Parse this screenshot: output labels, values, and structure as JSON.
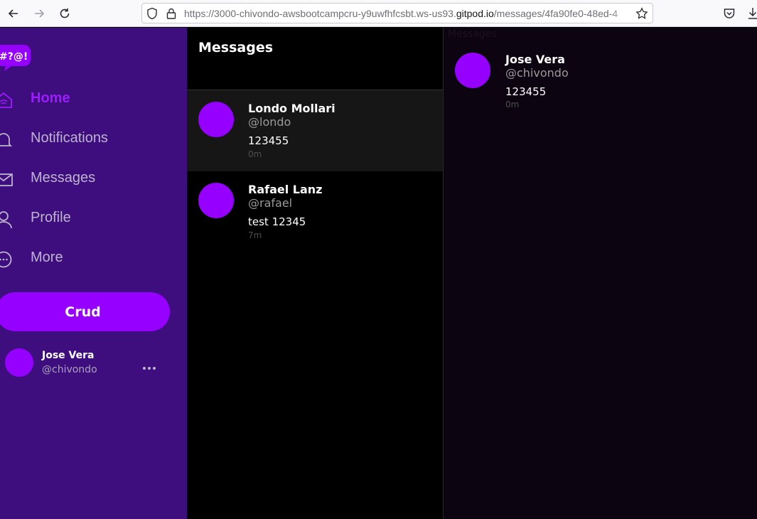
{
  "browser": {
    "url_prefix": "https://3000-chivondo-awsbootcampcru-y9uwfhfcsbt.ws-us93.",
    "url_domain": "gitpod.io",
    "url_suffix": "/messages/4fa90fe0-48ed-4",
    "icons": [
      "back-arrow-icon",
      "forward-arrow-icon",
      "reload-icon",
      "shield-icon",
      "lock-icon",
      "star-icon",
      "pocket-icon",
      "download-icon"
    ]
  },
  "sidebar": {
    "logo_text": "#?@!",
    "items": [
      {
        "label": "Home",
        "icon": "home-icon",
        "active": true
      },
      {
        "label": "Notifications",
        "icon": "bell-icon",
        "active": false
      },
      {
        "label": "Messages",
        "icon": "envelope-icon",
        "active": false
      },
      {
        "label": "Profile",
        "icon": "person-icon",
        "active": false
      },
      {
        "label": "More",
        "icon": "more-circle-icon",
        "active": false
      }
    ],
    "crud_label": "Crud",
    "profile": {
      "name": "Jose Vera",
      "handle": "@chivondo"
    }
  },
  "message_groups": {
    "title": "Messages",
    "items": [
      {
        "name": "Londo Mollari",
        "handle": "@londo",
        "message": "123455",
        "time": "0m",
        "selected": true
      },
      {
        "name": "Rafael Lanz",
        "handle": "@rafael",
        "message": "test 12345",
        "time": "7m",
        "selected": false
      }
    ]
  },
  "conversation": {
    "heading": "Messages",
    "messages": [
      {
        "name": "Jose Vera",
        "handle": "@chivondo",
        "message": "123455",
        "time": "0m"
      }
    ]
  },
  "colors": {
    "sidebar_bg": "#3e0e7f",
    "accent": "#9500ff",
    "active_nav": "#9c1bff",
    "conversation_bg": "#0d0412"
  }
}
